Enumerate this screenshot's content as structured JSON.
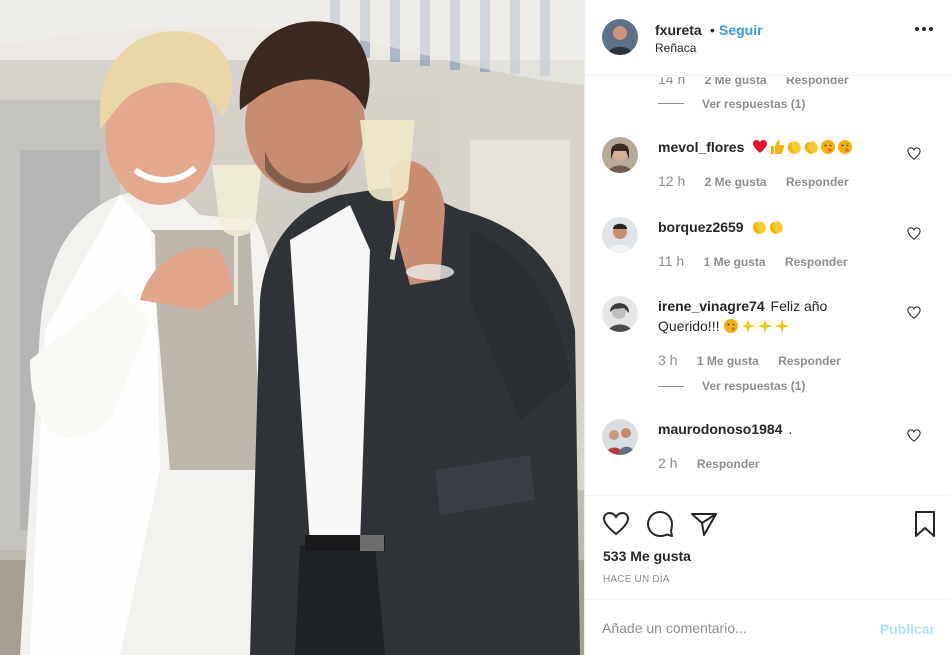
{
  "post": {
    "username": "fxureta",
    "separator": "•",
    "follow_label": "Seguir",
    "location": "Reñaca"
  },
  "thread_top": {
    "time": "14 h",
    "likes": "2 Me gusta",
    "reply": "Responder",
    "view_replies": "Ver respuestas (1)"
  },
  "comments": [
    {
      "user": "mevol_flores",
      "text": "",
      "emojis": [
        "heart",
        "thumbs",
        "clap",
        "clap",
        "face",
        "face"
      ],
      "time": "12 h",
      "likes": "2 Me gusta",
      "reply": "Responder"
    },
    {
      "user": "borquez2659",
      "text": "",
      "emojis": [
        "clap",
        "clap"
      ],
      "time": "11 h",
      "likes": "1 Me gusta",
      "reply": "Responder"
    },
    {
      "user": "irene_vinagre74",
      "text": "Feliz año",
      "text2": "Querido!!!",
      "emojis": [
        "face",
        "sparkle",
        "sparkle",
        "sparkle"
      ],
      "time": "3 h",
      "likes": "1 Me gusta",
      "reply": "Responder",
      "view_replies": "Ver respuestas (1)"
    },
    {
      "user": "maurodonoso1984",
      "text": ".",
      "emojis": [],
      "time": "2 h",
      "likes": "",
      "reply": "Responder"
    }
  ],
  "footer": {
    "likes_count": "533 Me gusta",
    "posted": "HACE UN DÍA",
    "comment_placeholder": "Añade un comentario...",
    "publish_label": "Publicar"
  },
  "icons": {
    "heart": "heart-icon",
    "comment": "comment-icon",
    "share": "paper-plane-icon",
    "save": "bookmark-icon",
    "more": "more-options-icon"
  },
  "colors": {
    "accent": "#3897f0",
    "publish_disabled": "#b2dffc",
    "muted": "#8e8e8e",
    "text": "#262626"
  }
}
